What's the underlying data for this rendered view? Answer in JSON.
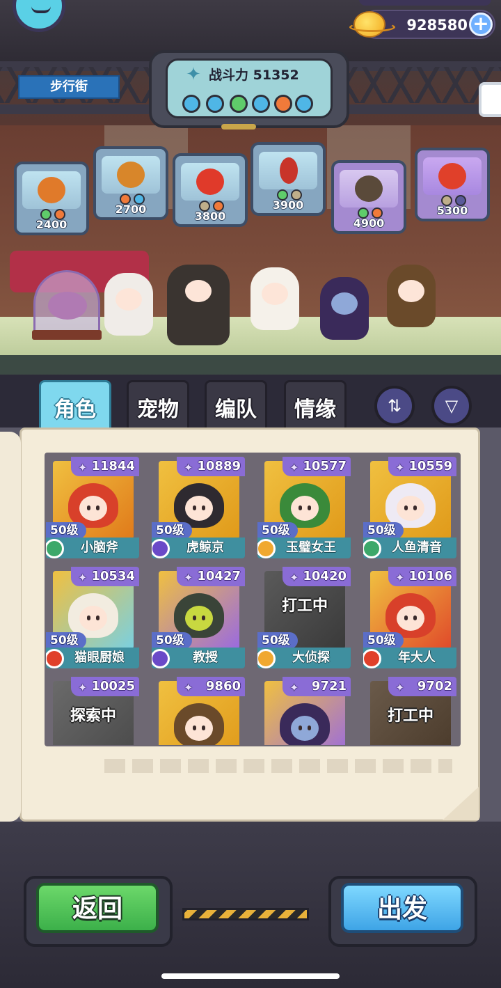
{
  "header": {
    "location": "步行街",
    "currency": "928580",
    "power_label": "战斗力",
    "power_value": "51352",
    "plus_icon": "+"
  },
  "colors": {
    "active_tab": "#7fd8ee",
    "name_strip": "#3f8f9f",
    "power_tag": "#8a6cd6",
    "back_button": "#4cc058",
    "go_button": "#4ab0ee"
  },
  "elements_row": [
    "water-icon",
    "water-icon",
    "leaf-icon",
    "water-icon",
    "fire-icon",
    "water-icon"
  ],
  "capsules": [
    {
      "cost": "2400"
    },
    {
      "cost": "2700"
    },
    {
      "cost": "3800"
    },
    {
      "cost": "3900"
    },
    {
      "cost": "4900"
    },
    {
      "cost": "5300"
    }
  ],
  "tabs": [
    "角色",
    "宠物",
    "编队",
    "情缘"
  ],
  "cards": [
    {
      "power": "11844",
      "level": "50级",
      "name": "小脑斧",
      "status": ""
    },
    {
      "power": "10889",
      "level": "50级",
      "name": "虎鲸京",
      "status": ""
    },
    {
      "power": "10577",
      "level": "50级",
      "name": "玉璧女王",
      "status": ""
    },
    {
      "power": "10559",
      "level": "50级",
      "name": "人鱼清音",
      "status": ""
    },
    {
      "power": "10534",
      "level": "50级",
      "name": "猫眼厨娘",
      "status": ""
    },
    {
      "power": "10427",
      "level": "50级",
      "name": "教授",
      "status": ""
    },
    {
      "power": "10420",
      "level": "50级",
      "name": "大侦探",
      "status": "打工中"
    },
    {
      "power": "10106",
      "level": "50级",
      "name": "年大人",
      "status": ""
    },
    {
      "power": "10025",
      "level": "",
      "name": "",
      "status": "探索中"
    },
    {
      "power": "9860",
      "level": "",
      "name": "",
      "status": ""
    },
    {
      "power": "9721",
      "level": "",
      "name": "",
      "status": ""
    },
    {
      "power": "9702",
      "level": "",
      "name": "",
      "status": "打工中"
    }
  ],
  "buttons": {
    "back": "返回",
    "go": "出发"
  }
}
